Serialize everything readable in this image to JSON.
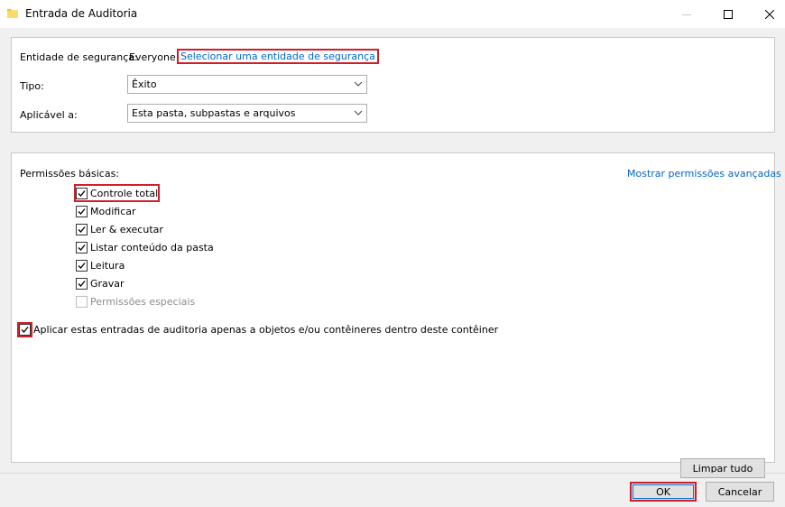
{
  "window": {
    "title": "Entrada de Auditoria"
  },
  "principal": {
    "label": "Entidade de segurança:",
    "value": "Everyone",
    "select_link": "Selecionar uma entidade de segurança"
  },
  "type": {
    "label": "Tipo:",
    "value": "Êxito"
  },
  "applies_to": {
    "label": "Aplicável a:",
    "value": "Esta pasta, subpastas e arquivos"
  },
  "permissions": {
    "heading": "Permissões básicas:",
    "advanced_link": "Mostrar permissões avançadas",
    "items": [
      {
        "label": "Controle total",
        "checked": true,
        "enabled": true
      },
      {
        "label": "Modificar",
        "checked": true,
        "enabled": true
      },
      {
        "label": "Ler & executar",
        "checked": true,
        "enabled": true
      },
      {
        "label": "Listar conteúdo da pasta",
        "checked": true,
        "enabled": true
      },
      {
        "label": "Leitura",
        "checked": true,
        "enabled": true
      },
      {
        "label": "Gravar",
        "checked": true,
        "enabled": true
      },
      {
        "label": "Permissões especiais",
        "checked": false,
        "enabled": false
      }
    ],
    "apply_only_label": "Aplicar estas entradas de auditoria apenas a objetos e/ou contêineres dentro deste contêiner",
    "apply_only_checked": true,
    "clear_all": "Limpar tudo"
  },
  "footer": {
    "ok": "OK",
    "cancel": "Cancelar"
  },
  "colors": {
    "link": "#0066cc",
    "highlight": "#d01f2a",
    "focus": "#0078d7"
  }
}
